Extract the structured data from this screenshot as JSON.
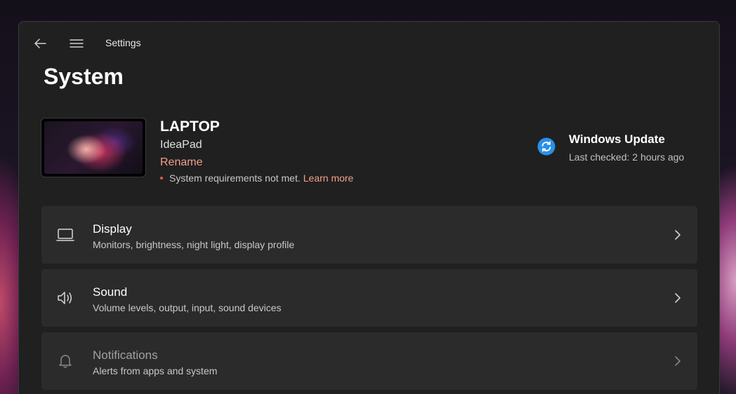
{
  "window": {
    "app_title": "Settings",
    "icons": {
      "back": "back-arrow-icon",
      "menu": "hamburger-menu-icon"
    }
  },
  "page": {
    "title": "System"
  },
  "device": {
    "name": "LAPTOP",
    "model": "IdeaPad",
    "rename_label": "Rename",
    "requirement_text": "System requirements not met.",
    "learn_more_label": "Learn more"
  },
  "windows_update": {
    "title": "Windows Update",
    "last_checked": "Last checked: 2 hours ago",
    "icon": "refresh-icon"
  },
  "cards": [
    {
      "title": "Display",
      "description": "Monitors, brightness, night light, display profile",
      "icon": "laptop-icon"
    },
    {
      "title": "Sound",
      "description": "Volume levels, output, input, sound devices",
      "icon": "speaker-icon"
    },
    {
      "title": "Notifications",
      "description": "Alerts from apps and system",
      "icon": "bell-icon"
    }
  ],
  "colors": {
    "accent_link": "#f0a088",
    "update_blue": "#2a8fe8",
    "warning_dot": "#e55a4c",
    "card_bg": "#2b2b2b",
    "window_bg": "#202020"
  }
}
